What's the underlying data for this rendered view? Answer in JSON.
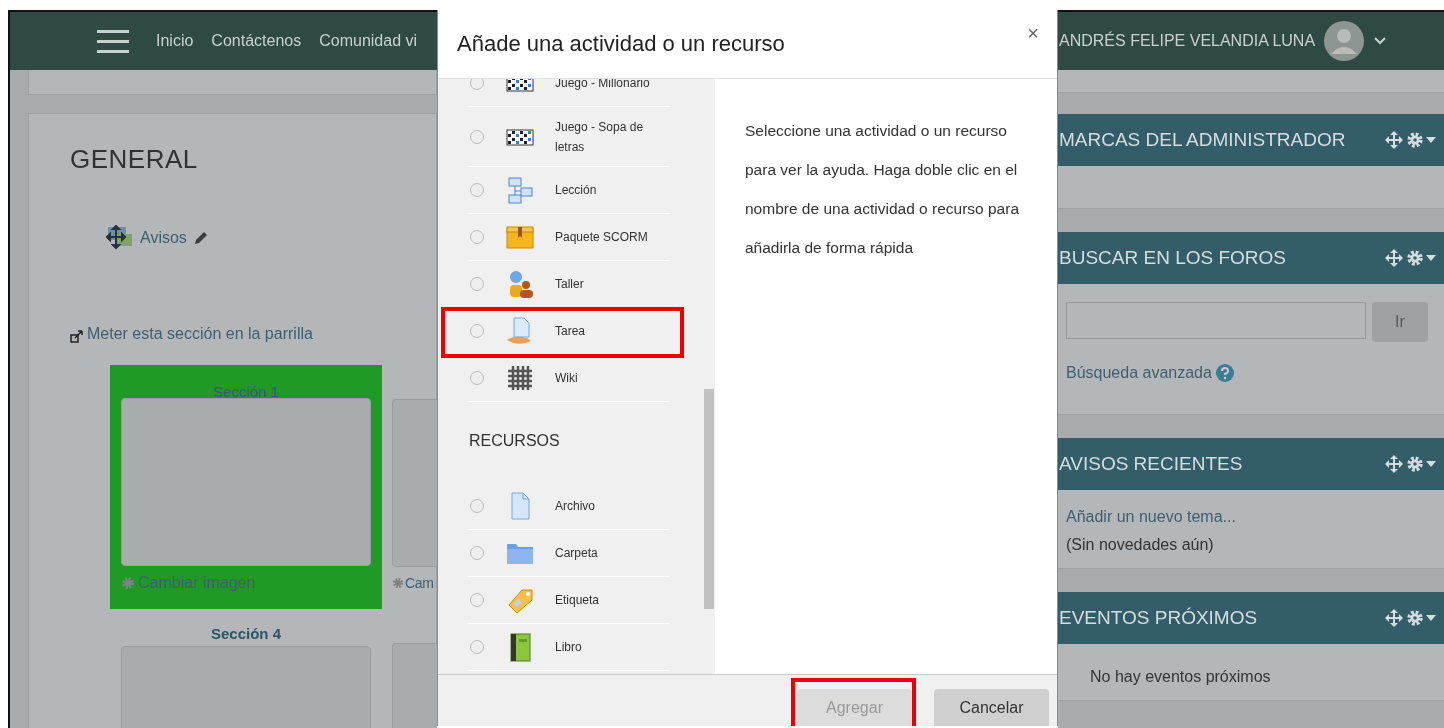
{
  "navbar": {
    "links": [
      "Inicio",
      "Contáctenos",
      "Comunidad vi"
    ],
    "user_name": "ANDRÉS FELIPE VELANDIA LUNA"
  },
  "course": {
    "section_title": "GENERAL",
    "forum_link": "Avisos",
    "grid_link": "Meter esta sección en la parrilla",
    "tiles": [
      {
        "title": "Sección 1",
        "action": "Cambiar imagen",
        "selected": true
      },
      {
        "title": "Sección 4",
        "selected": false
      }
    ],
    "side_tile": {
      "action": "Cam"
    }
  },
  "dialog": {
    "title": "Añade una actividad o un recurso",
    "close": "×",
    "activities": [
      {
        "label": "Juego - Millonario",
        "kind": "game",
        "selected": false,
        "highlighted": false
      },
      {
        "label": "Juego - Sopa de letras",
        "kind": "game",
        "selected": false,
        "highlighted": false
      },
      {
        "label": "Lección",
        "kind": "lesson",
        "selected": false,
        "highlighted": false
      },
      {
        "label": "Paquete SCORM",
        "kind": "package",
        "selected": false,
        "highlighted": false
      },
      {
        "label": "Taller",
        "kind": "workshop",
        "selected": false,
        "highlighted": false
      },
      {
        "label": "Tarea",
        "kind": "assignment",
        "selected": false,
        "highlighted": true
      },
      {
        "label": "Wiki",
        "kind": "wiki",
        "selected": false,
        "highlighted": false
      }
    ],
    "resources_heading": "RECURSOS",
    "resources": [
      {
        "label": "Archivo",
        "kind": "file",
        "selected": false,
        "highlighted": false
      },
      {
        "label": "Carpeta",
        "kind": "folder",
        "selected": false,
        "highlighted": false
      },
      {
        "label": "Etiqueta",
        "kind": "label",
        "selected": false,
        "highlighted": false
      },
      {
        "label": "Libro",
        "kind": "book",
        "selected": false,
        "highlighted": false
      }
    ],
    "help": "Seleccione una actividad o un recurso para ver la ayuda. Haga doble clic en el nombre de una actividad o recurso para añadirla de forma rápida",
    "buttons": [
      {
        "label": "Agregar",
        "disabled": true,
        "highlighted": true
      },
      {
        "label": "Cancelar",
        "disabled": false,
        "highlighted": false
      }
    ]
  },
  "blocks": [
    {
      "title": "MARCAS DEL ADMINISTRADOR",
      "kind": "empty"
    },
    {
      "title": "BUSCAR EN LOS FOROS",
      "kind": "search",
      "button": "Ir",
      "link": "Búsqueda avanzada"
    },
    {
      "title": "AVISOS RECIENTES",
      "kind": "news",
      "link": "Añadir un nuevo tema...",
      "text": "(Sin novedades aún)"
    },
    {
      "title": "EVENTOS PRÓXIMOS",
      "kind": "events",
      "text": "No hay eventos próximos"
    }
  ]
}
